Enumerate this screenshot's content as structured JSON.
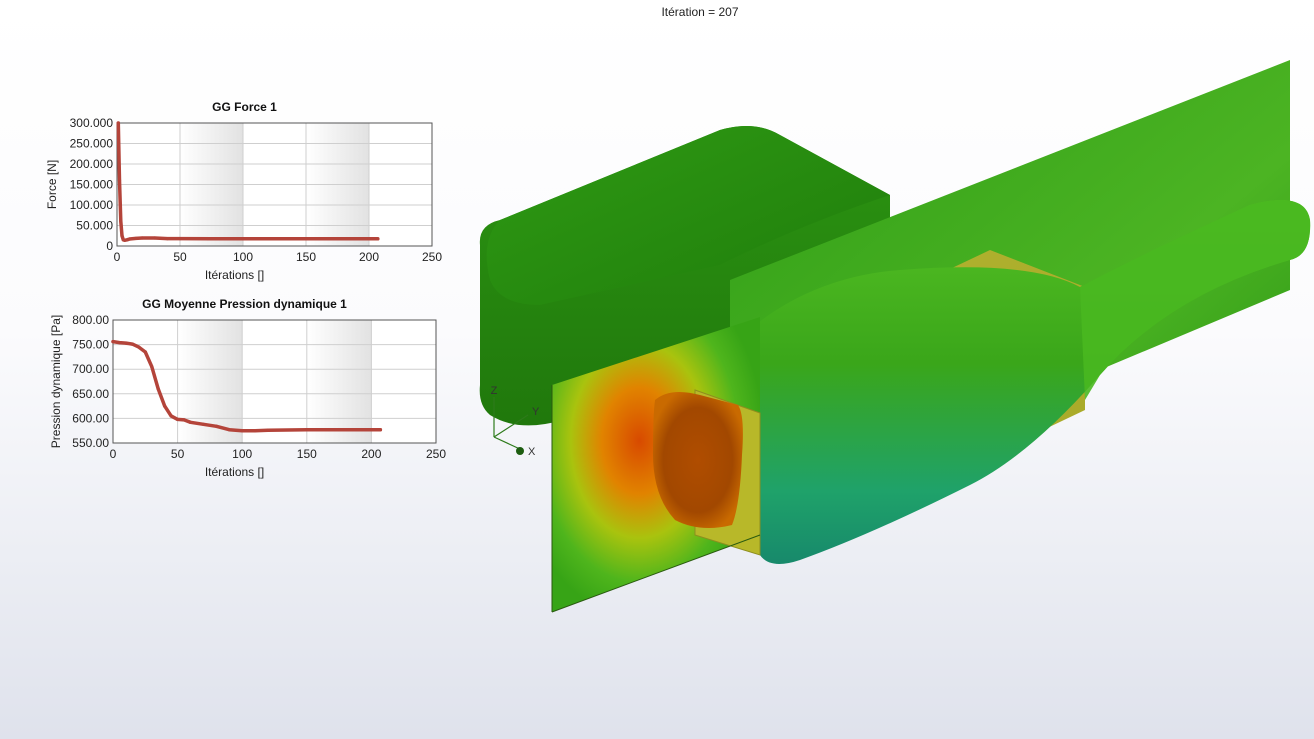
{
  "viewport": {
    "iteration_label": "Itération = 207",
    "triad_axes": [
      "Z",
      "Y",
      "X"
    ]
  },
  "chart_data": [
    {
      "type": "line",
      "title": "GG Force 1",
      "xlabel": "Itérations []",
      "ylabel": "Force [N]",
      "xlim": [
        0,
        250
      ],
      "ylim": [
        0,
        300000
      ],
      "xticks": [
        "0",
        "50",
        "100",
        "150",
        "200",
        "250"
      ],
      "yticks": [
        "0",
        "50.000",
        "100.000",
        "150.000",
        "200.000",
        "250.000",
        "300.000"
      ],
      "grid": true,
      "series": [
        {
          "color": "#b4443a",
          "x": [
            1,
            2,
            3,
            4,
            5,
            6,
            8,
            10,
            15,
            20,
            30,
            40,
            50,
            75,
            100,
            150,
            200,
            207
          ],
          "y": [
            300000,
            160000,
            60000,
            25000,
            15000,
            14000,
            15000,
            17000,
            18500,
            19500,
            19500,
            18000,
            18000,
            17500,
            17500,
            17500,
            17500,
            17500
          ]
        }
      ]
    },
    {
      "type": "line",
      "title": "GG Moyenne Pression dynamique 1",
      "xlabel": "Itérations []",
      "ylabel": "Pression dynamique [Pa]",
      "xlim": [
        0,
        250
      ],
      "ylim": [
        550,
        800
      ],
      "xticks": [
        "0",
        "50",
        "100",
        "150",
        "200",
        "250"
      ],
      "yticks": [
        "550.00",
        "600.00",
        "650.00",
        "700.00",
        "750.00",
        "800.00"
      ],
      "grid": true,
      "series": [
        {
          "color": "#b4443a",
          "x": [
            0,
            5,
            10,
            15,
            20,
            25,
            30,
            35,
            40,
            45,
            50,
            55,
            60,
            70,
            80,
            90,
            100,
            110,
            120,
            150,
            200,
            207
          ],
          "y": [
            756,
            754,
            753,
            751,
            745,
            735,
            705,
            660,
            625,
            605,
            598,
            597,
            592,
            588,
            584,
            577,
            575,
            575,
            576,
            577,
            577,
            577
          ]
        }
      ]
    }
  ]
}
